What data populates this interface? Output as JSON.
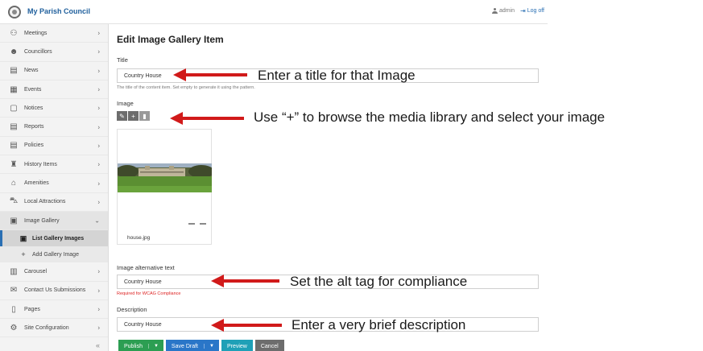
{
  "app": {
    "title": "My Parish Council",
    "user": "admin",
    "logoff_label": "Log off"
  },
  "sidebar": {
    "items": [
      {
        "label": "Meetings",
        "icon": "meetings-icon"
      },
      {
        "label": "Councillors",
        "icon": "users-icon"
      },
      {
        "label": "News",
        "icon": "news-icon"
      },
      {
        "label": "Events",
        "icon": "calendar-icon"
      },
      {
        "label": "Notices",
        "icon": "notice-icon"
      },
      {
        "label": "Reports",
        "icon": "document-icon"
      },
      {
        "label": "Policies",
        "icon": "document-icon"
      },
      {
        "label": "History Items",
        "icon": "monument-icon"
      },
      {
        "label": "Amenities",
        "icon": "basket-icon"
      },
      {
        "label": "Local Attractions",
        "icon": "car-icon"
      },
      {
        "label": "Image Gallery",
        "icon": "gallery-icon"
      },
      {
        "label": "Carousel",
        "icon": "carousel-icon"
      },
      {
        "label": "Contact Us Submissions",
        "icon": "envelope-icon"
      },
      {
        "label": "Pages",
        "icon": "page-icon"
      },
      {
        "label": "Site Configuration",
        "icon": "gears-icon"
      }
    ],
    "subitems": [
      {
        "label": "List Gallery Images",
        "icon": "list-images-icon"
      },
      {
        "label": "Add Gallery Image",
        "icon": "plus-icon"
      }
    ],
    "collapse_glyph": "«"
  },
  "form": {
    "heading": "Edit Image Gallery Item",
    "title_label": "Title",
    "title_value": "Country House",
    "title_hint": "The title of the content item. Set empty to generate it using the pattern.",
    "image_label": "Image",
    "image_filename": "house.jpg",
    "alt_label": "Image alternative text",
    "alt_value": "Country House",
    "alt_required": "Required for WCAG Compliance",
    "description_label": "Description",
    "description_value": "Country House"
  },
  "buttons": {
    "publish": "Publish",
    "save_draft": "Save Draft",
    "preview": "Preview",
    "cancel": "Cancel"
  },
  "annotations": {
    "title": "Enter a title for that Image",
    "image": "Use “+” to browse the media library and select your image",
    "alt": "Set the alt tag for compliance",
    "description": "Enter a very brief description"
  },
  "colors": {
    "brand": "#1f5f9c",
    "arrow": "#d11a1a",
    "publish": "#2c9e52",
    "save": "#2a76c8",
    "preview": "#1fa0b7",
    "cancel": "#6d6d6d"
  }
}
